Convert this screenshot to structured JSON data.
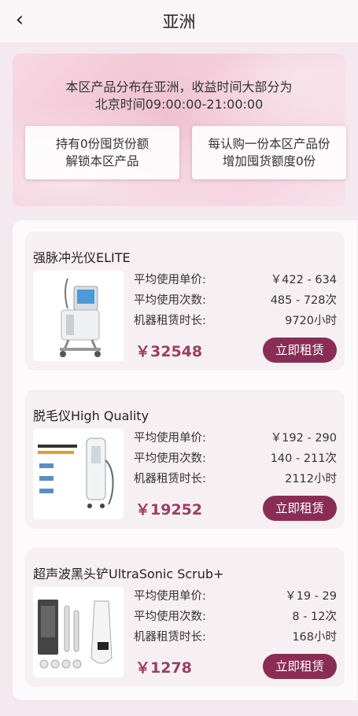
{
  "header": {
    "back_icon": "‹",
    "title": "亚洲"
  },
  "banner": {
    "line1": "本区产品分布在亚洲，收益时间大部分为",
    "line2": "北京时间09:00:00-21:00:00",
    "pill_left": {
      "line1": "持有0份囤货份额",
      "line2": "解锁本区产品"
    },
    "pill_right": {
      "line1": "每认购一份本区产品份",
      "line2": "增加囤货额度0份"
    }
  },
  "labels": {
    "unit_price": "平均使用单价:",
    "use_count": "平均使用次数:",
    "duration": "机器租赁时长:"
  },
  "products": [
    {
      "name": "强脉冲光仪ELITE",
      "unit_price": "￥422 - 634",
      "use_count": "485 - 728次",
      "duration": "9720小时",
      "price": "￥32548",
      "button": "立即租赁",
      "image_icon": "ipl-machine-icon"
    },
    {
      "name": "脱毛仪High Quality",
      "unit_price": "￥192 - 290",
      "use_count": "140 - 211次",
      "duration": "2112小时",
      "price": "￥19252",
      "button": "立即租赁",
      "image_icon": "hair-removal-machine-icon"
    },
    {
      "name": "超声波黑头铲UltraSonic Scrub+",
      "unit_price": "￥19 - 29",
      "use_count": "8 - 12次",
      "duration": "168小时",
      "price": "￥1278",
      "button": "立即租赁",
      "image_icon": "blackhead-remover-icon"
    }
  ],
  "colors": {
    "accent": "#8a2d55",
    "price": "#9b3e64",
    "banner": "#efc0cf"
  }
}
